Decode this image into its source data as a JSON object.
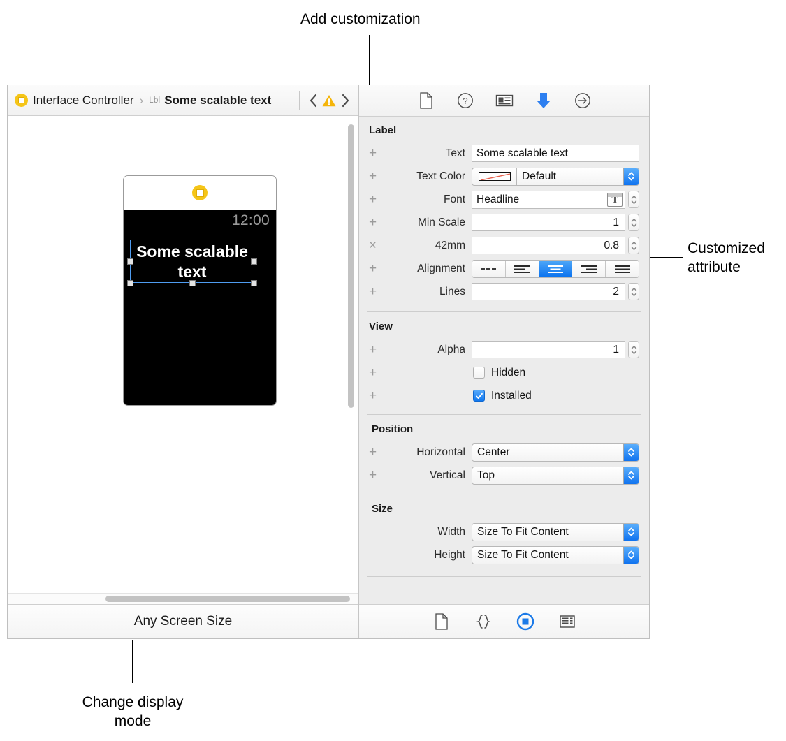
{
  "callouts": [
    {
      "id": "add-customization",
      "text": "Add customization"
    },
    {
      "id": "customized-attribute",
      "text": "Customized\nattribute"
    },
    {
      "id": "change-display-mode",
      "text": "Change display\nmode"
    }
  ],
  "jumpbar": {
    "controller_label": "Interface Controller",
    "separator": "›",
    "element_kind": "Lbl",
    "element_label": "Some scalable text",
    "back_arrow": "‹",
    "forward_arrow": "›",
    "warning_glyph": "!"
  },
  "canvas": {
    "watch": {
      "time": "12:00",
      "label_text": "Some scalable\ntext"
    },
    "display_mode": "Any Screen Size"
  },
  "inspector": {
    "toolbar_icons": [
      "file-inspector-icon",
      "quick-help-inspector-icon",
      "identity-inspector-icon",
      "attributes-inspector-icon",
      "connections-inspector-icon"
    ],
    "bottom_icons": [
      "file-template-library-icon",
      "code-snippet-library-icon",
      "object-library-icon",
      "media-library-icon"
    ],
    "sections": [
      {
        "title": "Label",
        "rows": [
          {
            "name": "text",
            "badge": "+",
            "label": "Text",
            "type": "textbox",
            "value": "Some scalable text"
          },
          {
            "name": "text-color",
            "badge": "+",
            "label": "Text Color",
            "type": "color-popup",
            "value": "Default",
            "swatch": "none-red-slash"
          },
          {
            "name": "font",
            "badge": "+",
            "label": "Font",
            "type": "font",
            "value": "Headline"
          },
          {
            "name": "min-scale",
            "badge": "+",
            "label": "Min Scale",
            "type": "number",
            "value": "1"
          },
          {
            "name": "42mm",
            "badge": "×",
            "label": "42mm",
            "type": "number",
            "value": "0.8"
          },
          {
            "name": "alignment",
            "badge": "+",
            "label": "Alignment",
            "type": "segmented",
            "options": [
              "default",
              "left",
              "center",
              "right",
              "justified"
            ],
            "selected": 2
          },
          {
            "name": "lines",
            "badge": "+",
            "label": "Lines",
            "type": "number",
            "value": "2"
          }
        ]
      },
      {
        "title": "View",
        "rows": [
          {
            "name": "alpha",
            "badge": "+",
            "label": "Alpha",
            "type": "number",
            "value": "1"
          },
          {
            "name": "hidden",
            "badge": "+",
            "label": "",
            "type": "checkbox",
            "value": "Hidden",
            "checked": false
          },
          {
            "name": "installed",
            "badge": "+",
            "label": "",
            "type": "checkbox",
            "value": "Installed",
            "checked": true
          }
        ]
      },
      {
        "title": "Position",
        "indented": true,
        "rows": [
          {
            "name": "horizontal",
            "badge": "+",
            "label": "Horizontal",
            "type": "popup",
            "value": "Center"
          },
          {
            "name": "vertical",
            "badge": "+",
            "label": "Vertical",
            "type": "popup",
            "value": "Top"
          }
        ]
      },
      {
        "title": "Size",
        "indented": true,
        "rows": [
          {
            "name": "width",
            "badge": "",
            "label": "Width",
            "type": "popup",
            "value": "Size To Fit Content"
          },
          {
            "name": "height",
            "badge": "",
            "label": "Height",
            "type": "popup",
            "value": "Size To Fit Content"
          }
        ]
      }
    ]
  },
  "colors": {
    "accent_blue": "#0a72ef",
    "warning_yellow": "#f5b50a",
    "panel_gray": "#ececec",
    "watch_screen": "#000000"
  }
}
